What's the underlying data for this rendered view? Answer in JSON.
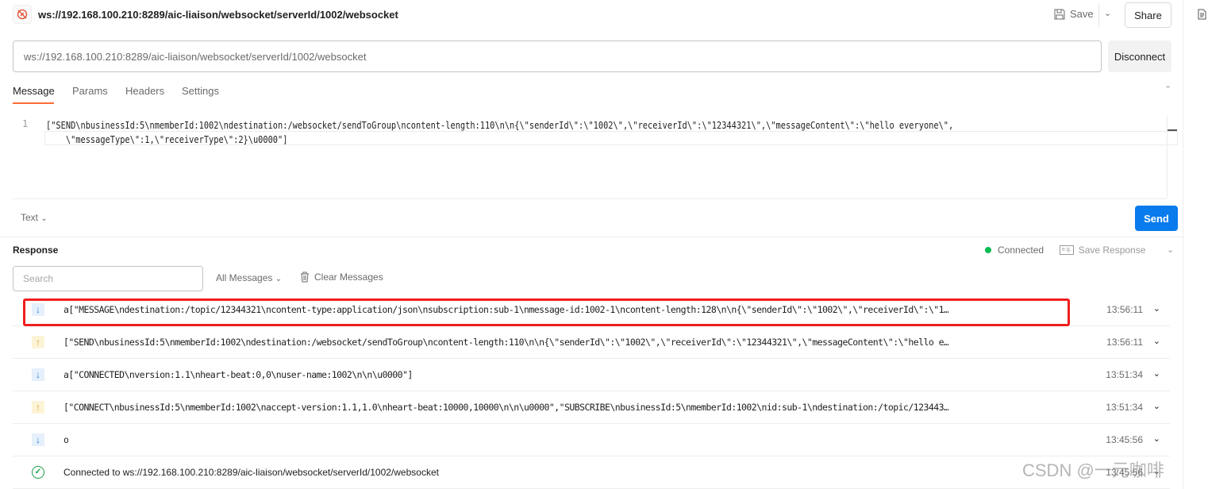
{
  "header": {
    "title": "ws://192.168.100.210:8289/aic-liaison/websocket/serverId/1002/websocket",
    "save_label": "Save",
    "share_label": "Share"
  },
  "url_bar": {
    "value": "ws://192.168.100.210:8289/aic-liaison/websocket/serverId/1002/websocket",
    "disconnect_label": "Disconnect"
  },
  "tabs": [
    {
      "label": "Message",
      "active": true
    },
    {
      "label": "Params"
    },
    {
      "label": "Headers"
    },
    {
      "label": "Settings"
    }
  ],
  "editor": {
    "line_number": "1",
    "line1": "[\"SEND\\nbusinessId:5\\nmemberId:1002\\ndestination:/websocket/sendToGroup\\ncontent-length:110\\n\\n{\\\"senderId\\\":\\\"1002\\\",\\\"receiverId\\\":\\\"12344321\\\",\\\"messageContent\\\":\\\"hello everyone\\\",",
    "line2": "    \\\"messageType\\\":1,\\\"receiverType\\\":2}\\u0000\"]",
    "format": "Text",
    "send_label": "Send"
  },
  "response": {
    "title": "Response",
    "status": "Connected",
    "status_color": "#0cbb52",
    "save_response_label": "Save Response",
    "search_placeholder": "Search",
    "filter": "All Messages",
    "clear_label": "Clear Messages",
    "messages": [
      {
        "direction": "in",
        "text": "a[\"MESSAGE\\ndestination:/topic/12344321\\ncontent-type:application/json\\nsubscription:sub-1\\nmessage-id:1002-1\\ncontent-length:128\\n\\n{\\\"senderId\\\":\\\"1002\\\",\\\"receiverId\\\":\\\"1…",
        "time": "13:56:11",
        "highlighted": true
      },
      {
        "direction": "out",
        "text": "[\"SEND\\nbusinessId:5\\nmemberId:1002\\ndestination:/websocket/sendToGroup\\ncontent-length:110\\n\\n{\\\"senderId\\\":\\\"1002\\\",\\\"receiverId\\\":\\\"12344321\\\",\\\"messageContent\\\":\\\"hello e…",
        "time": "13:56:11"
      },
      {
        "direction": "in",
        "text": "a[\"CONNECTED\\nversion:1.1\\nheart-beat:0,0\\nuser-name:1002\\n\\n\\u0000\"]",
        "time": "13:51:34"
      },
      {
        "direction": "out",
        "text": "[\"CONNECT\\nbusinessId:5\\nmemberId:1002\\naccept-version:1.1,1.0\\nheart-beat:10000,10000\\n\\n\\u0000\",\"SUBSCRIBE\\nbusinessId:5\\nmemberId:1002\\nid:sub-1\\ndestination:/topic/123443…",
        "time": "13:51:34"
      },
      {
        "direction": "in",
        "text": "o",
        "time": "13:45:56"
      },
      {
        "direction": "connected",
        "text": "Connected to ws://192.168.100.210:8289/aic-liaison/websocket/serverId/1002/websocket",
        "time": "13:45:56"
      }
    ]
  },
  "watermark": "CSDN @一元咖啡"
}
